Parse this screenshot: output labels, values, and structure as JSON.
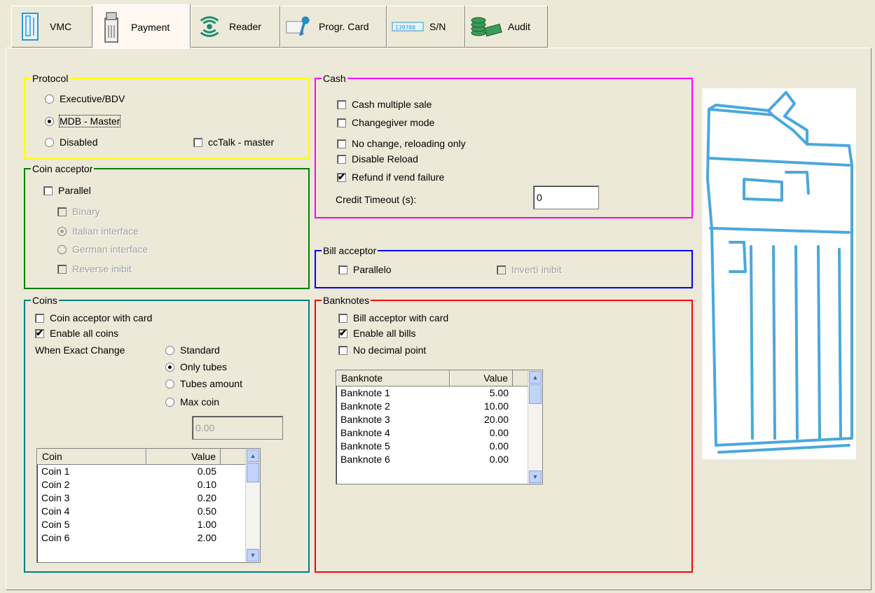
{
  "tabs": [
    {
      "label": "VMC",
      "icon": "vmc-machine-icon"
    },
    {
      "label": "Payment",
      "icon": "payment-machine-icon"
    },
    {
      "label": "Reader",
      "icon": "reader-wave-icon"
    },
    {
      "label": "Progr. Card",
      "icon": "key-card-icon"
    },
    {
      "label": "S/N",
      "icon": "serial-number-icon"
    },
    {
      "label": "Audit",
      "icon": "money-audit-icon"
    }
  ],
  "protocol": {
    "title": "Protocol",
    "executive": "Executive/BDV",
    "mdb": "MDB - Master",
    "disabled": "Disabled",
    "cctalk": "ccTalk - master",
    "selected": "MDB - Master",
    "color": "#ffff00"
  },
  "coin_acceptor": {
    "title": "Coin acceptor",
    "parallel": "Parallel",
    "binary": "Binary",
    "italian": "Italian interface",
    "german": "German interface",
    "reverse": "Reverse inibit",
    "color": "#008000"
  },
  "cash": {
    "title": "Cash",
    "multiple_sale": "Cash multiple sale",
    "changegiver": "Changegiver mode",
    "no_change": "No change, reloading only",
    "disable_reload": "Disable Reload",
    "refund": "Refund if vend failure",
    "timeout_label": "Credit Timeout (s):",
    "timeout_value": "0",
    "color": "#ff00ff"
  },
  "bill_acceptor": {
    "title": "Bill acceptor",
    "parallelo": "Parallelo",
    "invertit": "Invertì inibit",
    "color": "#0000ff"
  },
  "coins": {
    "title": "Coins",
    "with_card": "Coin acceptor with card",
    "enable_all": "Enable all coins",
    "exact_label": "When Exact Change",
    "standard": "Standard",
    "only_tubes": "Only tubes",
    "tubes_amount": "Tubes amount",
    "max_coin": "Max coin",
    "max_value": "0.00",
    "col_coin": "Coin",
    "col_value": "Value",
    "rows": [
      [
        "Coin 1",
        "0.05"
      ],
      [
        "Coin 2",
        "0.10"
      ],
      [
        "Coin 3",
        "0.20"
      ],
      [
        "Coin 4",
        "0.50"
      ],
      [
        "Coin 5",
        "1.00"
      ],
      [
        "Coin 6",
        "2.00"
      ]
    ],
    "color": "#008080"
  },
  "banknotes": {
    "title": "Banknotes",
    "with_card": "Bill acceptor with card",
    "enable_all": "Enable all bills",
    "no_decimal": "No decimal point",
    "col_banknote": "Banknote",
    "col_value": "Value",
    "rows": [
      [
        "Banknote 1",
        "5.00"
      ],
      [
        "Banknote 2",
        "10.00"
      ],
      [
        "Banknote 3",
        "20.00"
      ],
      [
        "Banknote 4",
        "0.00"
      ],
      [
        "Banknote 5",
        "0.00"
      ],
      [
        "Banknote 6",
        "0.00"
      ]
    ],
    "color": "#ff0000"
  }
}
